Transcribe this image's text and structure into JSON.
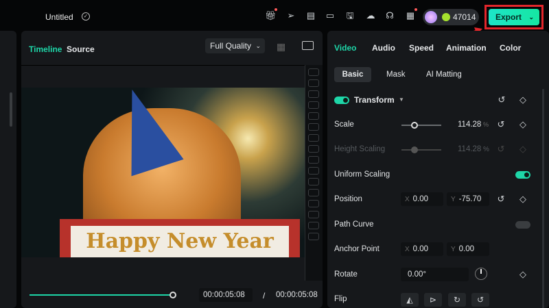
{
  "app": {
    "title": "Untitled",
    "credits": "47014",
    "export_label": "Export"
  },
  "toolbar_icons": [
    "gift-icon",
    "send-icon",
    "render-icon",
    "layout-icon",
    "save-icon",
    "cloud-upload-icon",
    "headset-icon",
    "grid-apps-icon"
  ],
  "preview": {
    "tabs": [
      "Timeline",
      "Source"
    ],
    "quality": "Full Quality",
    "sign_text": "Happy New Year",
    "current_time": "00:00:05:08",
    "separator": "/",
    "total_time": "00:00:05:08",
    "progress": 1.0
  },
  "inspector": {
    "tabs": [
      "Video",
      "Audio",
      "Speed",
      "Animation",
      "Color"
    ],
    "subtabs": [
      "Basic",
      "Mask",
      "AI Matting"
    ],
    "section": "Transform",
    "scale": {
      "label": "Scale",
      "value": "114.28",
      "unit": "%"
    },
    "height_scaling": {
      "label": "Height Scaling",
      "value": "114.28",
      "unit": "%"
    },
    "uniform_scaling": {
      "label": "Uniform Scaling",
      "on": true
    },
    "position": {
      "label": "Position",
      "x": "0.00",
      "y": "-75.70"
    },
    "path_curve": {
      "label": "Path Curve",
      "on": false
    },
    "anchor": {
      "label": "Anchor Point",
      "x": "0.00",
      "y": "0.00"
    },
    "rotate": {
      "label": "Rotate",
      "value": "0.00°"
    },
    "flip": {
      "label": "Flip"
    },
    "axis_x": "X",
    "axis_y": "Y"
  },
  "colors": {
    "accent": "#1ed6a8",
    "export_border": "#e3262b"
  }
}
